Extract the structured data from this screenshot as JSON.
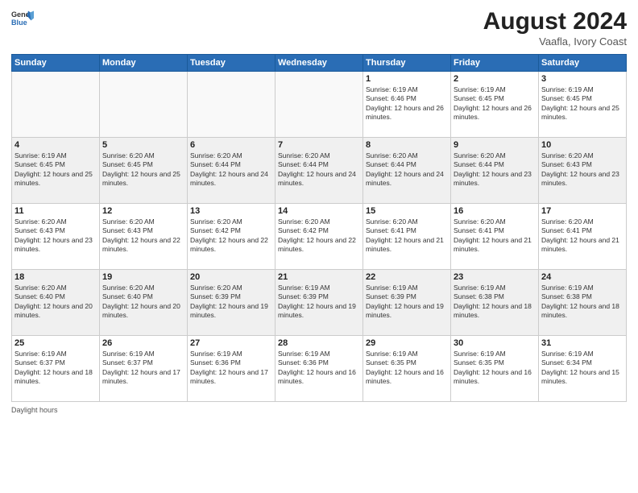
{
  "header": {
    "logo_general": "General",
    "logo_blue": "Blue",
    "month_year": "August 2024",
    "location": "Vaafla, Ivory Coast"
  },
  "days_of_week": [
    "Sunday",
    "Monday",
    "Tuesday",
    "Wednesday",
    "Thursday",
    "Friday",
    "Saturday"
  ],
  "footer": {
    "note": "Daylight hours"
  },
  "weeks": [
    [
      {
        "day": "",
        "empty": true
      },
      {
        "day": "",
        "empty": true
      },
      {
        "day": "",
        "empty": true
      },
      {
        "day": "",
        "empty": true
      },
      {
        "day": "1",
        "sunrise": "Sunrise: 6:19 AM",
        "sunset": "Sunset: 6:46 PM",
        "daylight": "Daylight: 12 hours and 26 minutes."
      },
      {
        "day": "2",
        "sunrise": "Sunrise: 6:19 AM",
        "sunset": "Sunset: 6:45 PM",
        "daylight": "Daylight: 12 hours and 26 minutes."
      },
      {
        "day": "3",
        "sunrise": "Sunrise: 6:19 AM",
        "sunset": "Sunset: 6:45 PM",
        "daylight": "Daylight: 12 hours and 25 minutes."
      }
    ],
    [
      {
        "day": "4",
        "sunrise": "Sunrise: 6:19 AM",
        "sunset": "Sunset: 6:45 PM",
        "daylight": "Daylight: 12 hours and 25 minutes."
      },
      {
        "day": "5",
        "sunrise": "Sunrise: 6:20 AM",
        "sunset": "Sunset: 6:45 PM",
        "daylight": "Daylight: 12 hours and 25 minutes."
      },
      {
        "day": "6",
        "sunrise": "Sunrise: 6:20 AM",
        "sunset": "Sunset: 6:44 PM",
        "daylight": "Daylight: 12 hours and 24 minutes."
      },
      {
        "day": "7",
        "sunrise": "Sunrise: 6:20 AM",
        "sunset": "Sunset: 6:44 PM",
        "daylight": "Daylight: 12 hours and 24 minutes."
      },
      {
        "day": "8",
        "sunrise": "Sunrise: 6:20 AM",
        "sunset": "Sunset: 6:44 PM",
        "daylight": "Daylight: 12 hours and 24 minutes."
      },
      {
        "day": "9",
        "sunrise": "Sunrise: 6:20 AM",
        "sunset": "Sunset: 6:44 PM",
        "daylight": "Daylight: 12 hours and 23 minutes."
      },
      {
        "day": "10",
        "sunrise": "Sunrise: 6:20 AM",
        "sunset": "Sunset: 6:43 PM",
        "daylight": "Daylight: 12 hours and 23 minutes."
      }
    ],
    [
      {
        "day": "11",
        "sunrise": "Sunrise: 6:20 AM",
        "sunset": "Sunset: 6:43 PM",
        "daylight": "Daylight: 12 hours and 23 minutes."
      },
      {
        "day": "12",
        "sunrise": "Sunrise: 6:20 AM",
        "sunset": "Sunset: 6:43 PM",
        "daylight": "Daylight: 12 hours and 22 minutes."
      },
      {
        "day": "13",
        "sunrise": "Sunrise: 6:20 AM",
        "sunset": "Sunset: 6:42 PM",
        "daylight": "Daylight: 12 hours and 22 minutes."
      },
      {
        "day": "14",
        "sunrise": "Sunrise: 6:20 AM",
        "sunset": "Sunset: 6:42 PM",
        "daylight": "Daylight: 12 hours and 22 minutes."
      },
      {
        "day": "15",
        "sunrise": "Sunrise: 6:20 AM",
        "sunset": "Sunset: 6:41 PM",
        "daylight": "Daylight: 12 hours and 21 minutes."
      },
      {
        "day": "16",
        "sunrise": "Sunrise: 6:20 AM",
        "sunset": "Sunset: 6:41 PM",
        "daylight": "Daylight: 12 hours and 21 minutes."
      },
      {
        "day": "17",
        "sunrise": "Sunrise: 6:20 AM",
        "sunset": "Sunset: 6:41 PM",
        "daylight": "Daylight: 12 hours and 21 minutes."
      }
    ],
    [
      {
        "day": "18",
        "sunrise": "Sunrise: 6:20 AM",
        "sunset": "Sunset: 6:40 PM",
        "daylight": "Daylight: 12 hours and 20 minutes."
      },
      {
        "day": "19",
        "sunrise": "Sunrise: 6:20 AM",
        "sunset": "Sunset: 6:40 PM",
        "daylight": "Daylight: 12 hours and 20 minutes."
      },
      {
        "day": "20",
        "sunrise": "Sunrise: 6:20 AM",
        "sunset": "Sunset: 6:39 PM",
        "daylight": "Daylight: 12 hours and 19 minutes."
      },
      {
        "day": "21",
        "sunrise": "Sunrise: 6:19 AM",
        "sunset": "Sunset: 6:39 PM",
        "daylight": "Daylight: 12 hours and 19 minutes."
      },
      {
        "day": "22",
        "sunrise": "Sunrise: 6:19 AM",
        "sunset": "Sunset: 6:39 PM",
        "daylight": "Daylight: 12 hours and 19 minutes."
      },
      {
        "day": "23",
        "sunrise": "Sunrise: 6:19 AM",
        "sunset": "Sunset: 6:38 PM",
        "daylight": "Daylight: 12 hours and 18 minutes."
      },
      {
        "day": "24",
        "sunrise": "Sunrise: 6:19 AM",
        "sunset": "Sunset: 6:38 PM",
        "daylight": "Daylight: 12 hours and 18 minutes."
      }
    ],
    [
      {
        "day": "25",
        "sunrise": "Sunrise: 6:19 AM",
        "sunset": "Sunset: 6:37 PM",
        "daylight": "Daylight: 12 hours and 18 minutes."
      },
      {
        "day": "26",
        "sunrise": "Sunrise: 6:19 AM",
        "sunset": "Sunset: 6:37 PM",
        "daylight": "Daylight: 12 hours and 17 minutes."
      },
      {
        "day": "27",
        "sunrise": "Sunrise: 6:19 AM",
        "sunset": "Sunset: 6:36 PM",
        "daylight": "Daylight: 12 hours and 17 minutes."
      },
      {
        "day": "28",
        "sunrise": "Sunrise: 6:19 AM",
        "sunset": "Sunset: 6:36 PM",
        "daylight": "Daylight: 12 hours and 16 minutes."
      },
      {
        "day": "29",
        "sunrise": "Sunrise: 6:19 AM",
        "sunset": "Sunset: 6:35 PM",
        "daylight": "Daylight: 12 hours and 16 minutes."
      },
      {
        "day": "30",
        "sunrise": "Sunrise: 6:19 AM",
        "sunset": "Sunset: 6:35 PM",
        "daylight": "Daylight: 12 hours and 16 minutes."
      },
      {
        "day": "31",
        "sunrise": "Sunrise: 6:19 AM",
        "sunset": "Sunset: 6:34 PM",
        "daylight": "Daylight: 12 hours and 15 minutes."
      }
    ]
  ]
}
